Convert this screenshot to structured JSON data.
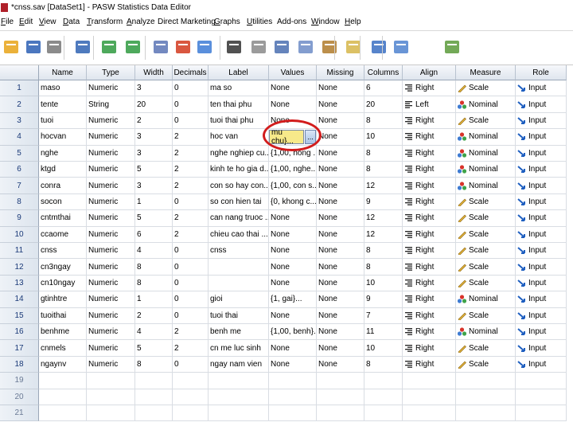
{
  "window": {
    "title": "*cnss.sav [DataSet1] - PASW Statistics Data Editor"
  },
  "menu": [
    {
      "label": "File",
      "ul": "F",
      "rest": "ile"
    },
    {
      "label": "Edit",
      "ul": "E",
      "rest": "dit"
    },
    {
      "label": "View",
      "ul": "V",
      "rest": "iew"
    },
    {
      "label": "Data",
      "ul": "D",
      "rest": "ata"
    },
    {
      "label": "Transform",
      "ul": "T",
      "rest": "ransform"
    },
    {
      "label": "Analyze",
      "ul": "A",
      "rest": "nalyze"
    },
    {
      "label": "Direct Marketing",
      "ul": "",
      "rest": "Direct Marketing"
    },
    {
      "label": "Graphs",
      "ul": "G",
      "rest": "raphs"
    },
    {
      "label": "Utilities",
      "ul": "U",
      "rest": "tilities"
    },
    {
      "label": "Add-ons",
      "ul": "",
      "rest": "Add-ons"
    },
    {
      "label": "Window",
      "ul": "W",
      "rest": "indow"
    },
    {
      "label": "Help",
      "ul": "H",
      "rest": "elp"
    }
  ],
  "toolbar": [
    "open-folder-icon",
    "save-disk-icon",
    "print-icon",
    "recall-dialog-icon",
    "undo-icon",
    "redo-icon",
    "goto-case-icon",
    "goto-variable-icon",
    "variables-icon",
    "find-binoculars-icon",
    "insert-cases-icon",
    "insert-variable-icon",
    "split-file-icon",
    "weight-cases-icon",
    "select-cases-icon",
    "value-labels-icon",
    "use-sets-icon",
    "spell-check-icon"
  ],
  "columns": [
    "Name",
    "Type",
    "Width",
    "Decimals",
    "Label",
    "Values",
    "Missing",
    "Columns",
    "Align",
    "Measure",
    "Role"
  ],
  "rows": [
    {
      "n": "1",
      "name": "maso",
      "type": "Numeric",
      "width": "3",
      "dec": "0",
      "label": "ma so",
      "values": "None",
      "missing": "None",
      "cols": "6",
      "align": "Right",
      "measure": "Scale",
      "role": "Input"
    },
    {
      "n": "2",
      "name": "tente",
      "type": "String",
      "width": "20",
      "dec": "0",
      "label": "ten thai phu",
      "values": "None",
      "missing": "None",
      "cols": "20",
      "align": "Left",
      "measure": "Nominal",
      "role": "Input"
    },
    {
      "n": "3",
      "name": "tuoi",
      "type": "Numeric",
      "width": "2",
      "dec": "0",
      "label": "tuoi thai phu",
      "values": "None",
      "missing": "None",
      "cols": "8",
      "align": "Right",
      "measure": "Scale",
      "role": "Input"
    },
    {
      "n": "4",
      "name": "hocvan",
      "type": "Numeric",
      "width": "3",
      "dec": "2",
      "label": "hoc van",
      "values": "mu chu}...",
      "missing": "None",
      "cols": "10",
      "align": "Right",
      "measure": "Nominal",
      "role": "Input"
    },
    {
      "n": "5",
      "name": "nghe",
      "type": "Numeric",
      "width": "3",
      "dec": "2",
      "label": "nghe nghiep cu...",
      "values": "{1,00, nong ...",
      "missing": "None",
      "cols": "8",
      "align": "Right",
      "measure": "Nominal",
      "role": "Input"
    },
    {
      "n": "6",
      "name": "ktgd",
      "type": "Numeric",
      "width": "5",
      "dec": "2",
      "label": "kinh te ho gia d...",
      "values": "{1,00, nghe...",
      "missing": "None",
      "cols": "8",
      "align": "Right",
      "measure": "Nominal",
      "role": "Input"
    },
    {
      "n": "7",
      "name": "conra",
      "type": "Numeric",
      "width": "3",
      "dec": "2",
      "label": "con so hay con...",
      "values": "{1,00, con s...",
      "missing": "None",
      "cols": "12",
      "align": "Right",
      "measure": "Nominal",
      "role": "Input"
    },
    {
      "n": "8",
      "name": "socon",
      "type": "Numeric",
      "width": "1",
      "dec": "0",
      "label": "so con hien tai",
      "values": "{0, khong c...",
      "missing": "None",
      "cols": "9",
      "align": "Right",
      "measure": "Scale",
      "role": "Input"
    },
    {
      "n": "9",
      "name": "cntmthai",
      "type": "Numeric",
      "width": "5",
      "dec": "2",
      "label": "can nang truoc ...",
      "values": "None",
      "missing": "None",
      "cols": "12",
      "align": "Right",
      "measure": "Scale",
      "role": "Input"
    },
    {
      "n": "10",
      "name": "ccaome",
      "type": "Numeric",
      "width": "6",
      "dec": "2",
      "label": "chieu cao thai ...",
      "values": "None",
      "missing": "None",
      "cols": "12",
      "align": "Right",
      "measure": "Scale",
      "role": "Input"
    },
    {
      "n": "11",
      "name": "cnss",
      "type": "Numeric",
      "width": "4",
      "dec": "0",
      "label": "cnss",
      "values": "None",
      "missing": "None",
      "cols": "8",
      "align": "Right",
      "measure": "Scale",
      "role": "Input"
    },
    {
      "n": "12",
      "name": "cn3ngay",
      "type": "Numeric",
      "width": "8",
      "dec": "0",
      "label": "",
      "values": "None",
      "missing": "None",
      "cols": "8",
      "align": "Right",
      "measure": "Scale",
      "role": "Input"
    },
    {
      "n": "13",
      "name": "cn10ngay",
      "type": "Numeric",
      "width": "8",
      "dec": "0",
      "label": "",
      "values": "None",
      "missing": "None",
      "cols": "10",
      "align": "Right",
      "measure": "Scale",
      "role": "Input"
    },
    {
      "n": "14",
      "name": "gtinhtre",
      "type": "Numeric",
      "width": "1",
      "dec": "0",
      "label": "gioi",
      "values": "{1, gai}...",
      "missing": "None",
      "cols": "9",
      "align": "Right",
      "measure": "Nominal",
      "role": "Input"
    },
    {
      "n": "15",
      "name": "tuoithai",
      "type": "Numeric",
      "width": "2",
      "dec": "0",
      "label": "tuoi thai",
      "values": "None",
      "missing": "None",
      "cols": "7",
      "align": "Right",
      "measure": "Scale",
      "role": "Input"
    },
    {
      "n": "16",
      "name": "benhme",
      "type": "Numeric",
      "width": "4",
      "dec": "2",
      "label": "benh me",
      "values": "{1,00, benh}...",
      "missing": "None",
      "cols": "11",
      "align": "Right",
      "measure": "Nominal",
      "role": "Input"
    },
    {
      "n": "17",
      "name": "cnmels",
      "type": "Numeric",
      "width": "5",
      "dec": "2",
      "label": "cn me luc sinh",
      "values": "None",
      "missing": "None",
      "cols": "10",
      "align": "Right",
      "measure": "Scale",
      "role": "Input"
    },
    {
      "n": "18",
      "name": "ngaynv",
      "type": "Numeric",
      "width": "8",
      "dec": "0",
      "label": "ngay nam vien",
      "values": "None",
      "missing": "None",
      "cols": "8",
      "align": "Right",
      "measure": "Scale",
      "role": "Input"
    }
  ],
  "empty_rows": [
    "19",
    "20",
    "21"
  ],
  "editing": {
    "value": "mu chu}...",
    "button": "..."
  },
  "colors": {
    "header_bg": "#dfe6ee",
    "edit_bg": "#f7e98a",
    "highlight": "#d21c1c"
  }
}
